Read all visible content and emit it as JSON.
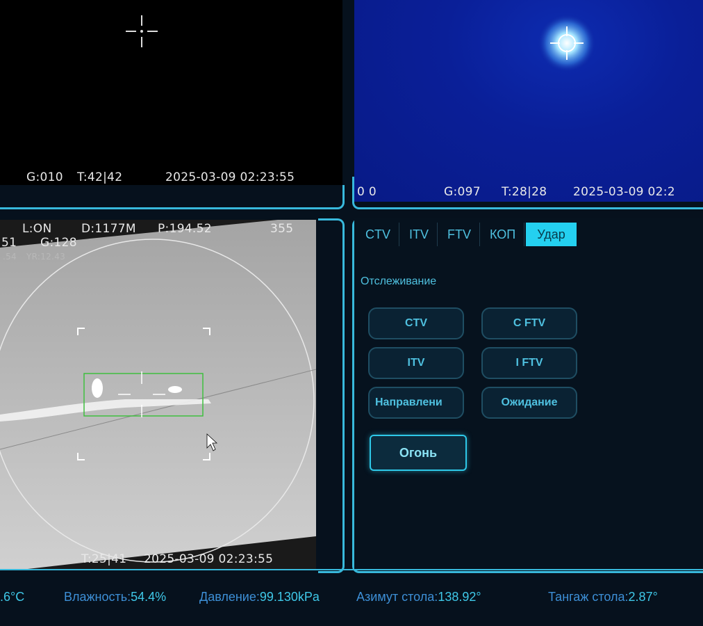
{
  "feeds": {
    "top_left": {
      "g": "G:010",
      "t": "T:42|42",
      "datetime": "2025-03-09  02:23:55"
    },
    "top_right": {
      "left": "0  0",
      "g": "G:097",
      "t": "T:28|28",
      "datetime": "2025-03-09  02:2"
    },
    "bottom_left": {
      "l": "L:ON",
      "d": "D:1177M",
      "p": "P:194.52",
      "num": "355",
      "left_num": "51",
      "g": "G:128",
      "small_left": ".54",
      "small_yr": "YR:12.43",
      "t": "T:25|41",
      "datetime": "2025-03-09  02:23:55"
    }
  },
  "control": {
    "tabs": [
      "CTV",
      "ITV",
      "FTV",
      "КОП",
      "Удар"
    ],
    "active_tab": "Удар",
    "section_label": "Отслеживание",
    "buttons": {
      "ctv": "CTV",
      "cftv": "C FTV",
      "itv": "ITV",
      "iftv": "I FTV",
      "direction": "Направлени",
      "waiting": "Ожидание",
      "fire": "Огонь"
    }
  },
  "status": {
    "temp_value": ".6°C",
    "humidity_label": "Влажность:",
    "humidity_value": "54.4%",
    "pressure_label": "Давление:",
    "pressure_value": "99.130kPa",
    "azimuth_label": "Азимут стола:",
    "azimuth_value": "138.92°",
    "pitch_label": "Тангаж стола:",
    "pitch_value": "2.87°"
  },
  "colors": {
    "accent": "#24d0f0",
    "frame": "#38b9dc",
    "status_label": "#3d8fd6"
  }
}
